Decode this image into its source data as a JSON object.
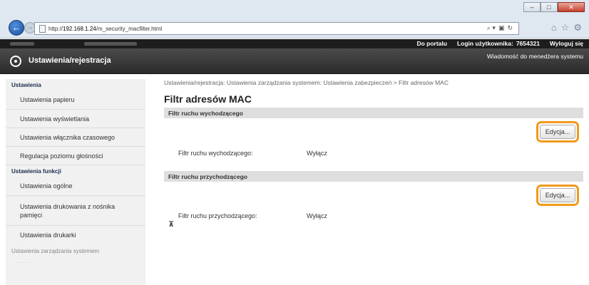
{
  "browser": {
    "url_prefix": "http://",
    "url_host": "192.168.1.24",
    "url_path": "/m_security_macfilter.html",
    "search_icon": "search-icon",
    "nav_icons": [
      "home-icon",
      "star-icon",
      "gear-icon"
    ],
    "window_controls": [
      "minimize",
      "maximize",
      "close"
    ]
  },
  "topbar": {
    "portal_link": "Do portalu",
    "login_label": "Login użytkownika:",
    "login_value": "7654321",
    "logout_link": "Wyloguj się"
  },
  "header": {
    "title": "Ustawienia/rejestracja",
    "message_link": "Wiadomość do menedżera systemu"
  },
  "sidebar": {
    "section1": "Ustawienia",
    "items1": [
      "Ustawienia papieru",
      "Ustawienia wyświetlania",
      "Ustawienia włącznika czasowego",
      "Regulacja poziomu głośności"
    ],
    "section2": "Ustawienia funkcji",
    "items2": [
      "Ustawienia ogólne",
      "Ustawienia drukowania z nośnika pamięci",
      "Ustawienia drukarki"
    ],
    "section3": "Ustawienia zarządzania systemem"
  },
  "main": {
    "breadcrumb": "Ustawienia/rejestracja: Ustawienia zarządzania systemem: Ustawienia zabezpieczeń > Filtr adresów MAC",
    "page_title": "Filtr adresów MAC",
    "outgoing": {
      "heading": "Filtr ruchu wychodzącego",
      "edit_label": "Edycja...",
      "row_label": "Filtr ruchu wychodzącego:",
      "row_value": "Wyłącz"
    },
    "incoming": {
      "heading": "Filtr ruchu przychodzącego",
      "edit_label": "Edycja...",
      "row_label": "Filtr ruchu przychodzącego:",
      "row_value": "Wyłącz"
    },
    "top_link": "⊼"
  },
  "colors": {
    "highlight": "#f19a1b",
    "header_bg": "#2b2b2b",
    "sidebar_head": "#1c2d4f"
  }
}
